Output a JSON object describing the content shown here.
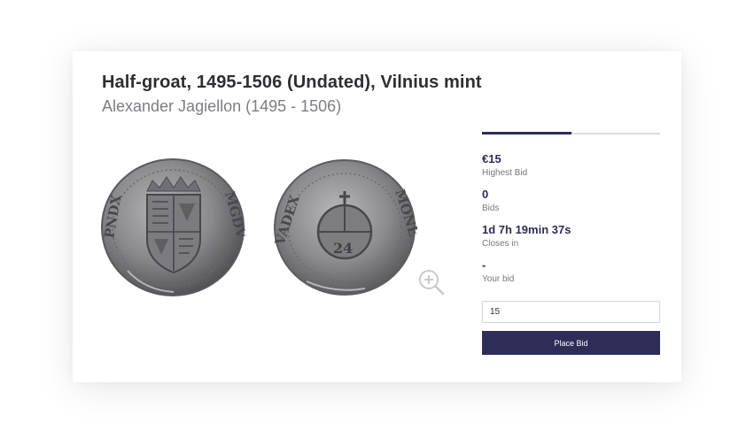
{
  "lot": {
    "title": "Half-groat, 1495-1506 (Undated), Vilnius mint",
    "subtitle": "Alexander Jagiellon (1495 - 1506)"
  },
  "images": {
    "obverse_alt": "Coin obverse",
    "reverse_alt": "Coin reverse",
    "zoom_icon": "zoom-in-icon"
  },
  "auction": {
    "time_progress_percent": 50,
    "highest_bid": {
      "value": "€15",
      "label": "Highest Bid"
    },
    "bids": {
      "value": "0",
      "label": "Bids"
    },
    "closes_in": {
      "value": "1d 7h 19min 37s",
      "label": "Closes in"
    },
    "your_bid": {
      "value": "-",
      "label": "Your bid"
    },
    "bid_input_value": "15",
    "place_bid_label": "Place Bid"
  },
  "colors": {
    "accent": "#2d2d57",
    "title": "#2e2e33",
    "subtitle": "#7d7d82",
    "coin_silver": "#8b8b8e"
  }
}
